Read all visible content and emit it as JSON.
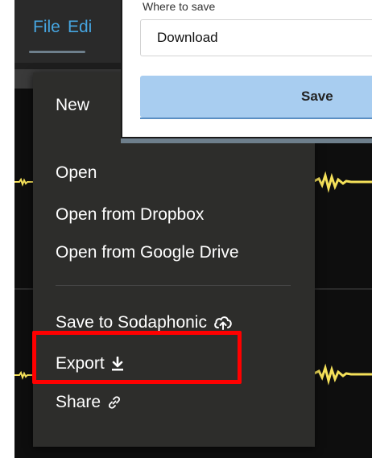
{
  "menubar": {
    "file_label": "File",
    "edit_label": "Edi"
  },
  "file_menu": {
    "items": [
      {
        "label": "New"
      },
      {
        "label": "Open"
      },
      {
        "label": "Open from Dropbox"
      },
      {
        "label": "Open from Google Drive"
      },
      {
        "label": "Save to Sodaphonic",
        "icon": "cloud-upload-icon"
      },
      {
        "label": "Export",
        "icon": "download-icon"
      },
      {
        "label": "Share",
        "icon": "link-icon"
      }
    ]
  },
  "save_dialog": {
    "where_label": "Where to save",
    "location_value": "Download",
    "save_button_label": "Save"
  },
  "colors": {
    "menu_title": "#46a5e0",
    "menu_bg": "#2d2d2b",
    "waveform": "#f5e15a",
    "highlight": "#ff0000",
    "save_button": "#a8cdf0"
  }
}
